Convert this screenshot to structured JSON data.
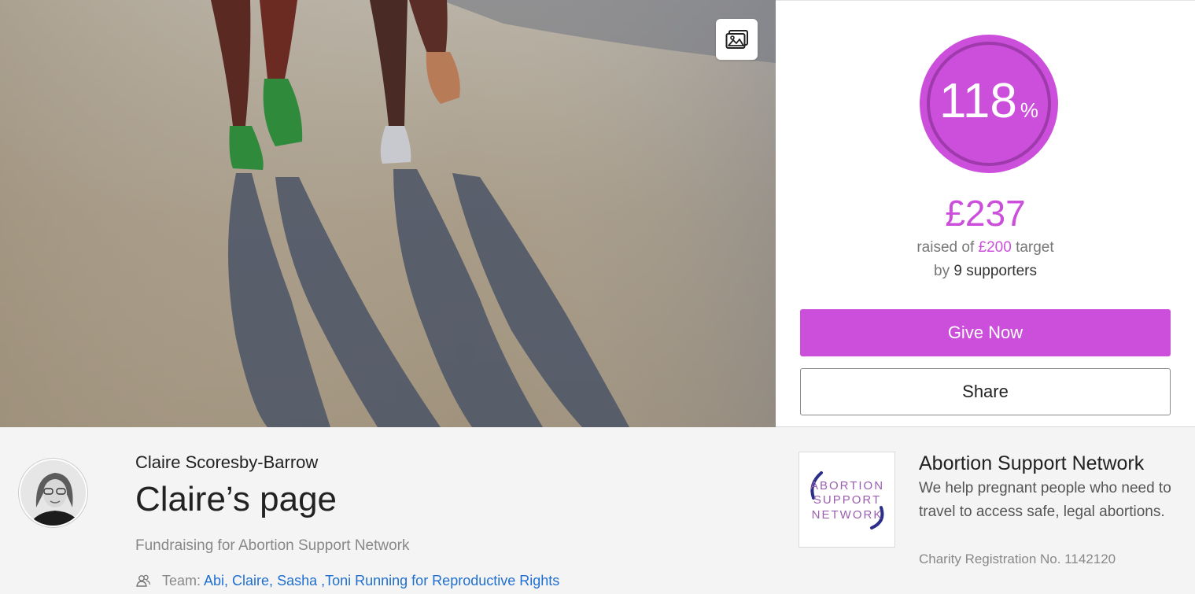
{
  "hero": {
    "gallery_icon": "image-gallery-icon"
  },
  "progress": {
    "percent": "118",
    "percent_sign": "%",
    "fraction": 1.18,
    "raised": "£237",
    "raised_prefix": "raised of",
    "target": "£200",
    "target_suffix": "target",
    "by": "by",
    "supporters": "9 supporters"
  },
  "actions": {
    "give_label": "Give Now",
    "share_label": "Share"
  },
  "fundraiser": {
    "owner": "Claire Scoresby-Barrow",
    "page_title": "Claire’s page",
    "fundraising_for": "Fundraising for Abortion Support Network",
    "team_label": "Team:",
    "team_link": "Abi, Claire, Sasha ,Toni Running for Reproductive Rights"
  },
  "charity": {
    "name": "Abortion Support Network",
    "description": "We help pregnant people who need to travel to access safe, legal abortions.",
    "registration": "Charity Registration No. 1142120",
    "logo_lines": [
      "ABORTION",
      "SUPPORT",
      "NETWORK"
    ]
  },
  "colors": {
    "accent": "#cc4fdc",
    "link": "#1f6fd1"
  }
}
